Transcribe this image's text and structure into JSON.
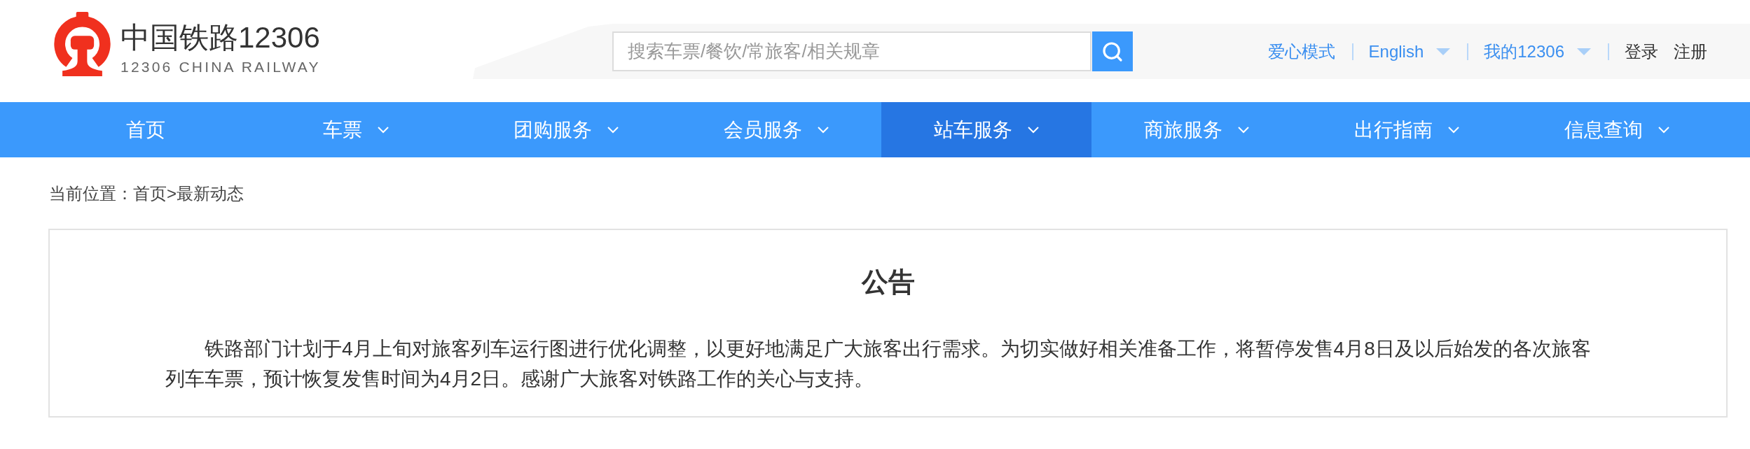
{
  "logo": {
    "title": "中国铁路12306",
    "subtitle": "12306 CHINA RAILWAY"
  },
  "search": {
    "placeholder": "搜索车票/餐饮/常旅客/相关规章"
  },
  "top_links": [
    {
      "label": "爱心模式",
      "kind": "link"
    },
    {
      "label": "English",
      "kind": "dropdown"
    },
    {
      "label": "我的12306",
      "kind": "dropdown"
    },
    {
      "label": "登录",
      "kind": "account"
    },
    {
      "label": "注册",
      "kind": "account"
    }
  ],
  "nav": {
    "items": [
      {
        "label": "首页",
        "has_menu": false,
        "selected": false
      },
      {
        "label": "车票",
        "has_menu": true,
        "selected": false
      },
      {
        "label": "团购服务",
        "has_menu": true,
        "selected": false
      },
      {
        "label": "会员服务",
        "has_menu": true,
        "selected": false
      },
      {
        "label": "站车服务",
        "has_menu": true,
        "selected": true
      },
      {
        "label": "商旅服务",
        "has_menu": true,
        "selected": false
      },
      {
        "label": "出行指南",
        "has_menu": true,
        "selected": false
      },
      {
        "label": "信息查询",
        "has_menu": true,
        "selected": false
      }
    ]
  },
  "breadcrumb": {
    "label": "当前位置：",
    "separator": ">",
    "items": [
      "首页",
      "最新动态"
    ]
  },
  "notice": {
    "title": "公告",
    "body": "铁路部门计划于4月上旬对旅客列车运行图进行优化调整，以更好地满足广大旅客出行需求。为切实做好相关准备工作，将暂停发售4月8日及以后始发的各次旅客列车车票，预计恢复发售时间为4月2日。感谢广大旅客对铁路工作的关心与支持。"
  }
}
